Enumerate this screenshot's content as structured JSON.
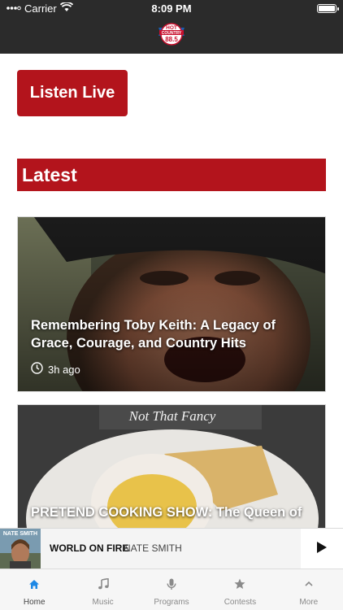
{
  "status_bar": {
    "carrier": "Carrier",
    "time": "8:09 PM"
  },
  "logo": {
    "line1": "HOT",
    "line2": "COUNTRY",
    "line3": "88.5"
  },
  "listen_live": {
    "label": "Listen Live"
  },
  "latest": {
    "heading": "Latest"
  },
  "articles": [
    {
      "title": "Remembering Toby Keith: A Legacy of Grace, Courage, and Country Hits",
      "time": "3h ago"
    },
    {
      "title": "PRETEND COOKING SHOW: The Queen of",
      "image_caption": "Not That Fancy"
    }
  ],
  "now_playing": {
    "album_text": "NATE SMITH",
    "song": "WORLD ON FIRE",
    "artist": "NATE SMITH"
  },
  "tabs": [
    {
      "label": "Home",
      "icon": "home-icon",
      "active": true
    },
    {
      "label": "Music",
      "icon": "music-note-icon"
    },
    {
      "label": "Programs",
      "icon": "microphone-icon"
    },
    {
      "label": "Contests",
      "icon": "star-icon"
    },
    {
      "label": "More",
      "icon": "chevron-up-icon"
    }
  ],
  "colors": {
    "brand_red": "#b3141c",
    "header_dark": "#2b2b2b",
    "tab_active": "#1e88e5"
  }
}
